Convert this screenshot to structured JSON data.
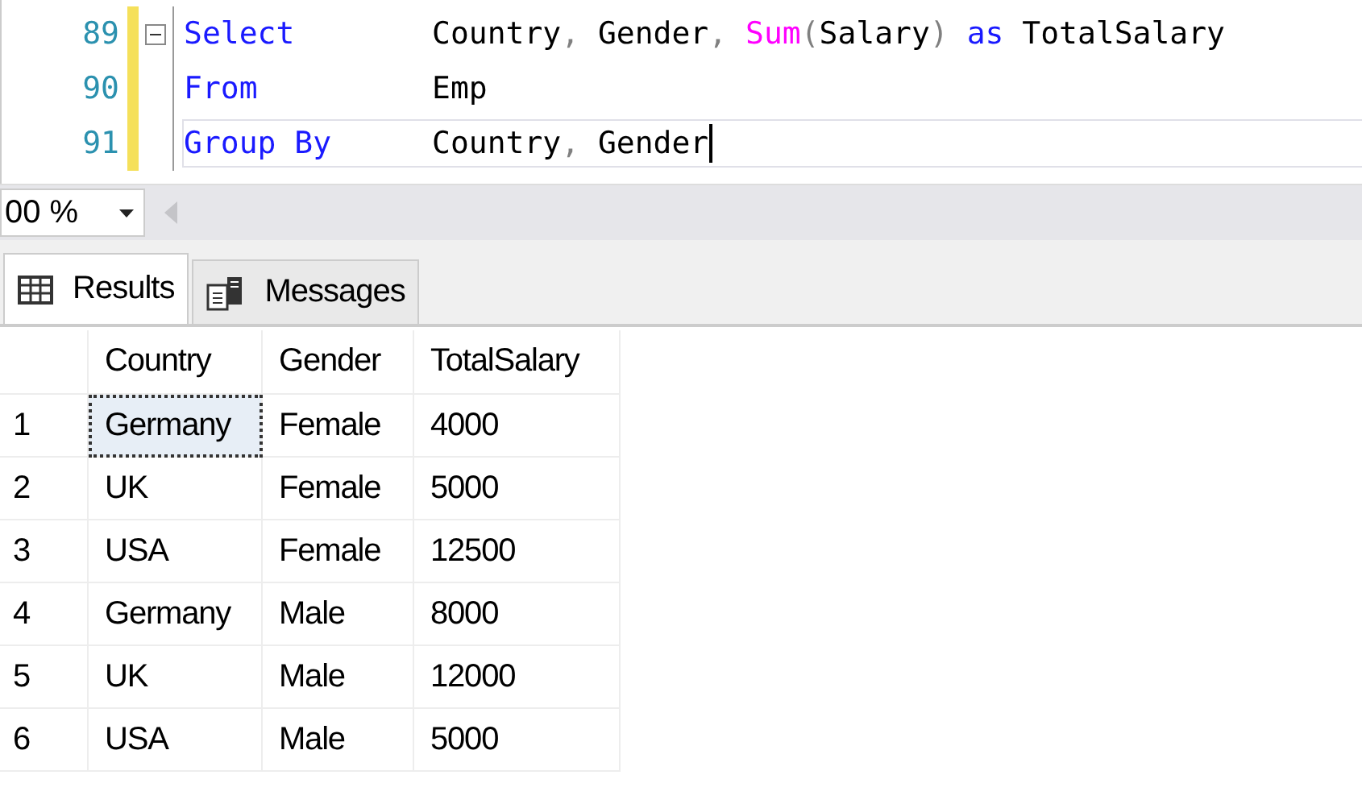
{
  "editor": {
    "lines": [
      {
        "number": "89",
        "collapsible": true,
        "current": false,
        "tokens": [
          {
            "text": "Select",
            "kind": "keyword"
          },
          {
            "text": "Country",
            "kind": "plain"
          },
          {
            "text": ", ",
            "kind": "punct"
          },
          {
            "text": "Gender",
            "kind": "plain"
          },
          {
            "text": ", ",
            "kind": "punct"
          },
          {
            "text": "Sum",
            "kind": "func"
          },
          {
            "text": "(",
            "kind": "punct"
          },
          {
            "text": "Salary",
            "kind": "plain"
          },
          {
            "text": ") ",
            "kind": "punct"
          },
          {
            "text": "as",
            "kind": "keyword"
          },
          {
            "text": " TotalSalary",
            "kind": "plain"
          }
        ]
      },
      {
        "number": "90",
        "collapsible": false,
        "current": false,
        "tokens": [
          {
            "text": "From",
            "kind": "keyword"
          },
          {
            "text": "Emp",
            "kind": "plain"
          }
        ]
      },
      {
        "number": "91",
        "collapsible": false,
        "current": true,
        "tokens": [
          {
            "text": "Group By",
            "kind": "keyword"
          },
          {
            "text": "Country",
            "kind": "plain"
          },
          {
            "text": ", ",
            "kind": "punct"
          },
          {
            "text": "Gender",
            "kind": "plain"
          }
        ]
      }
    ]
  },
  "zoom": {
    "value": "00 %"
  },
  "tabs": [
    {
      "label": "Results",
      "selected": true
    },
    {
      "label": "Messages",
      "selected": false
    }
  ],
  "results": {
    "columns": [
      "Country",
      "Gender",
      "TotalSalary"
    ],
    "rows": [
      {
        "number": "1",
        "cells": [
          {
            "text": "Germany",
            "selected": true
          },
          {
            "text": "Female",
            "selected": false
          },
          {
            "text": "4000",
            "selected": false
          }
        ]
      },
      {
        "number": "2",
        "cells": [
          {
            "text": "UK",
            "selected": false
          },
          {
            "text": "Female",
            "selected": false
          },
          {
            "text": "5000",
            "selected": false
          }
        ]
      },
      {
        "number": "3",
        "cells": [
          {
            "text": "USA",
            "selected": false
          },
          {
            "text": "Female",
            "selected": false
          },
          {
            "text": "12500",
            "selected": false
          }
        ]
      },
      {
        "number": "4",
        "cells": [
          {
            "text": "Germany",
            "selected": false
          },
          {
            "text": "Male",
            "selected": false
          },
          {
            "text": "8000",
            "selected": false
          }
        ]
      },
      {
        "number": "5",
        "cells": [
          {
            "text": "UK",
            "selected": false
          },
          {
            "text": "Male",
            "selected": false
          },
          {
            "text": "12000",
            "selected": false
          }
        ]
      },
      {
        "number": "6",
        "cells": [
          {
            "text": "USA",
            "selected": false
          },
          {
            "text": "Male",
            "selected": false
          },
          {
            "text": "5000",
            "selected": false
          }
        ]
      }
    ]
  }
}
